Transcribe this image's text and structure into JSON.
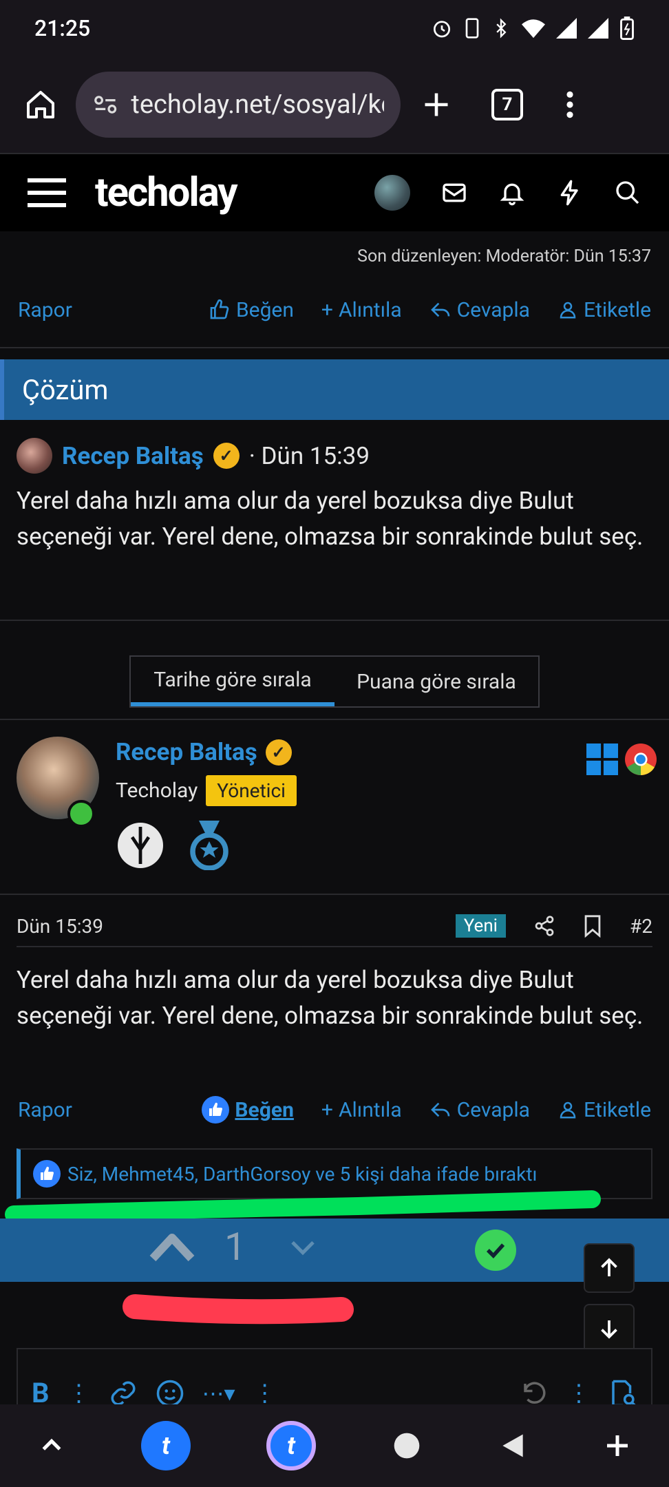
{
  "status_bar": {
    "time": "21:25"
  },
  "browser": {
    "url": "techolay.net/sosyal/kc",
    "tab_count": "7"
  },
  "header": {
    "logo": "techolay"
  },
  "post1": {
    "edit_note": "Son düzenleyen: Moderatör: Dün 15:37",
    "actions": {
      "report": "Rapor",
      "like": "Beğen",
      "quote": "Alıntıla",
      "reply": "Cevapla",
      "tag": "Etiketle"
    }
  },
  "solution": {
    "title": "Çözüm",
    "author": "Recep Baltaş",
    "time": "· Dün 15:39",
    "text": "Yerel daha hızlı ama olur da yerel bozuksa diye Bulut seçeneği var. Yerel dene, olmazsa bir sonrakinde bulut seç."
  },
  "sort": {
    "by_date": "Tarihe göre sırala",
    "by_score": "Puana göre sırala"
  },
  "post2": {
    "author": "Recep Baltaş",
    "site": "Techolay",
    "role": "Yönetici",
    "time": "Dün 15:39",
    "badge_new": "Yeni",
    "number": "#2",
    "text": "Yerel daha hızlı ama olur da yerel bozuksa diye Bulut seçeneği var. Yerel dene, olmazsa bir sonrakinde bulut seç.",
    "actions": {
      "report": "Rapor",
      "like": "Beğen",
      "quote": "Alıntıla",
      "reply": "Cevapla",
      "tag": "Etiketle"
    },
    "reactions": "Siz, Mehmet45, DarthGorsoy ve 5 kişi daha ifade bıraktı",
    "vote_count": "1"
  },
  "colors": {
    "accent": "#2f8fd6",
    "header_blue": "#1d5f96",
    "highlight_green": "#00e05a",
    "highlight_red": "#ff3b4f"
  }
}
